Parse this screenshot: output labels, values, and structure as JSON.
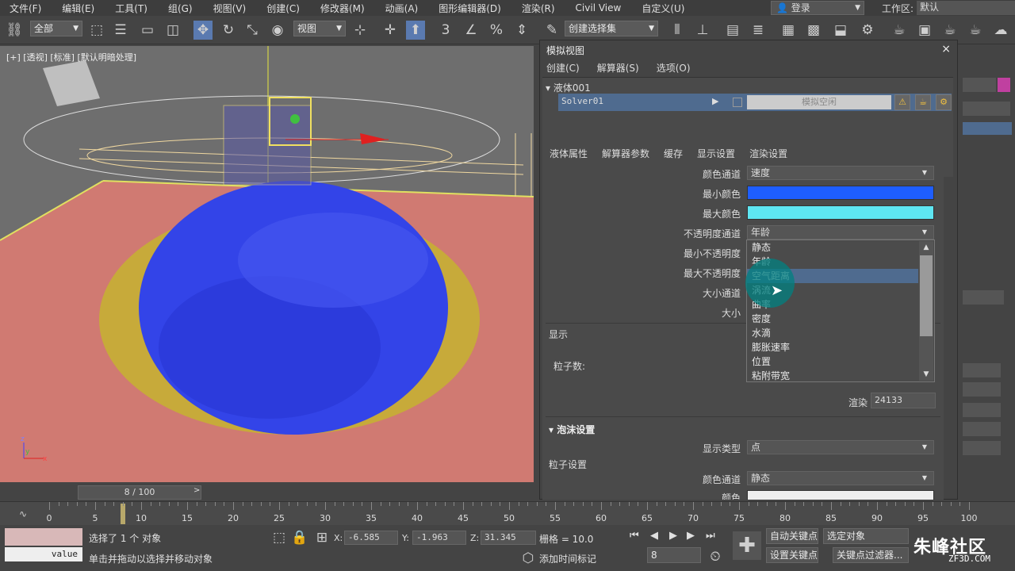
{
  "menubar": {
    "items": [
      "文件(F)",
      "编辑(E)",
      "工具(T)",
      "组(G)",
      "视图(V)",
      "创建(C)",
      "修改器(M)",
      "动画(A)",
      "图形编辑器(D)",
      "渲染(R)",
      "Civil View",
      "自定义(U)"
    ],
    "login": "登录",
    "workspace_label": "工作区:",
    "workspace_value": "默认"
  },
  "toolbar": {
    "selection_filter": "全部",
    "reference_coord": "视图",
    "named_selection": "创建选择集"
  },
  "viewport": {
    "label": "[+] [透视] [标准] [默认明暗处理]"
  },
  "sim_window": {
    "title": "模拟视图",
    "close": "×",
    "submenu": [
      "创建(C)",
      "解算器(S)",
      "选项(O)"
    ],
    "tree_root": "液体001",
    "solver_name": "Solver01",
    "sim_button": "模拟空闲",
    "tabs": [
      "液体属性",
      "解算器参数",
      "缓存",
      "显示设置",
      "渲染设置"
    ],
    "active_tab": "显示设置",
    "color_channel_label": "颜色通道",
    "color_channel_value": "速度",
    "min_color_label": "最小颜色",
    "min_color": "#1e5eff",
    "max_color_label": "最大颜色",
    "max_color": "#5ee6f2",
    "opacity_channel_label": "不透明度通道",
    "opacity_channel_value": "年龄",
    "min_opacity_label": "最小不透明度",
    "max_opacity_label": "最大不透明度",
    "size_channel_label": "大小通道",
    "size_label": "大小",
    "display_group": "显示",
    "particle_count_label": "粒子数:",
    "render_label": "渲染",
    "render_value": "24133",
    "foam_section": "泡沫设置",
    "display_type_label": "显示类型",
    "display_type_value": "点",
    "particle_settings_group": "粒子设置",
    "foam_color_channel_label": "颜色通道",
    "foam_color_channel_value": "静态",
    "foam_color_label": "颜色"
  },
  "dropdown_options": [
    "静态",
    "年龄",
    "空气距离",
    "涡流",
    "曲率",
    "密度",
    "水滴",
    "膨胀速率",
    "位置",
    "粘附带宽"
  ],
  "dropdown_selected": "空气距离",
  "frame_slider": {
    "value": "8 / 100",
    "prev": "<",
    "next": ">"
  },
  "timeline": {
    "ticks": [
      "0",
      "5",
      "10",
      "15",
      "20",
      "25",
      "30",
      "35",
      "40",
      "45",
      "50",
      "55",
      "60",
      "65",
      "70",
      "75",
      "80",
      "85",
      "90",
      "95",
      "100"
    ],
    "current_frame": 8,
    "total_frames": 100
  },
  "statusbar": {
    "value_label": "value",
    "selection_status": "选择了 1 个 对象",
    "prompt": "单击并拖动以选择并移动对象",
    "x_label": "X:",
    "x_value": "-6.585",
    "y_label": "Y:",
    "y_value": "-1.963",
    "z_label": "Z:",
    "z_value": "31.345",
    "grid": "栅格 = 10.0",
    "add_time_tag": "添加时间标记",
    "auto_key": "自动关键点",
    "selected_object": "选定对象",
    "set_key": "设置关键点",
    "key_filters": "关键点过滤器...",
    "frame_field": "8"
  },
  "watermark": {
    "text": "朱峰社区",
    "sub": "ZF3D.COM"
  }
}
